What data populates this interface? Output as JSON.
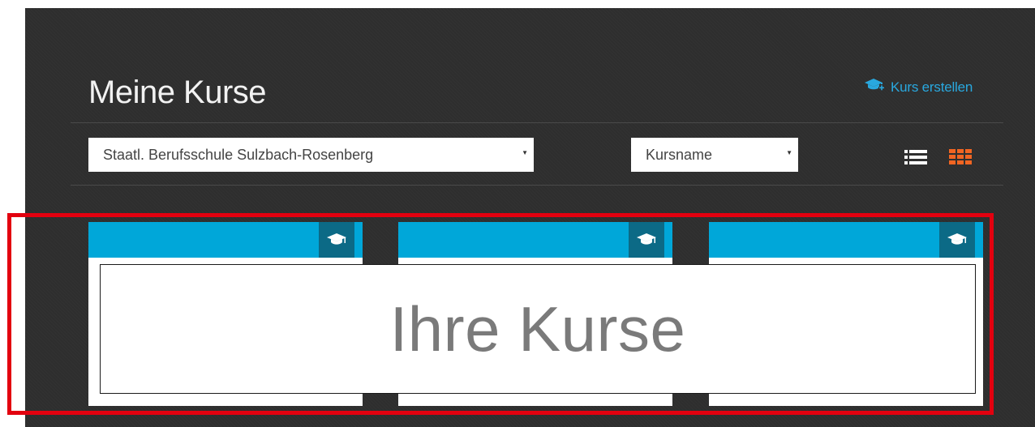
{
  "page": {
    "title": "Meine Kurse",
    "create_course_label": "Kurs erstellen"
  },
  "filters": {
    "school_select_value": "Staatl. Berufsschule Sulzbach-Rosenberg",
    "sort_select_value": "Kursname"
  },
  "view_toggle": {
    "list_icon": "list-icon",
    "grid_icon": "grid-icon",
    "active": "grid"
  },
  "courses": [
    {
      "icon": "graduation-cap-icon"
    },
    {
      "icon": "graduation-cap-icon"
    },
    {
      "icon": "graduation-cap-icon"
    }
  ],
  "overlay": {
    "label": "Ihre Kurse"
  },
  "colors": {
    "background": "#2e2e2e",
    "accent_blue": "#00a7d9",
    "cap_box": "#0c6a86",
    "link_blue": "#29a8df",
    "grid_icon_active": "#f26522",
    "highlight_red": "#e3000f"
  }
}
